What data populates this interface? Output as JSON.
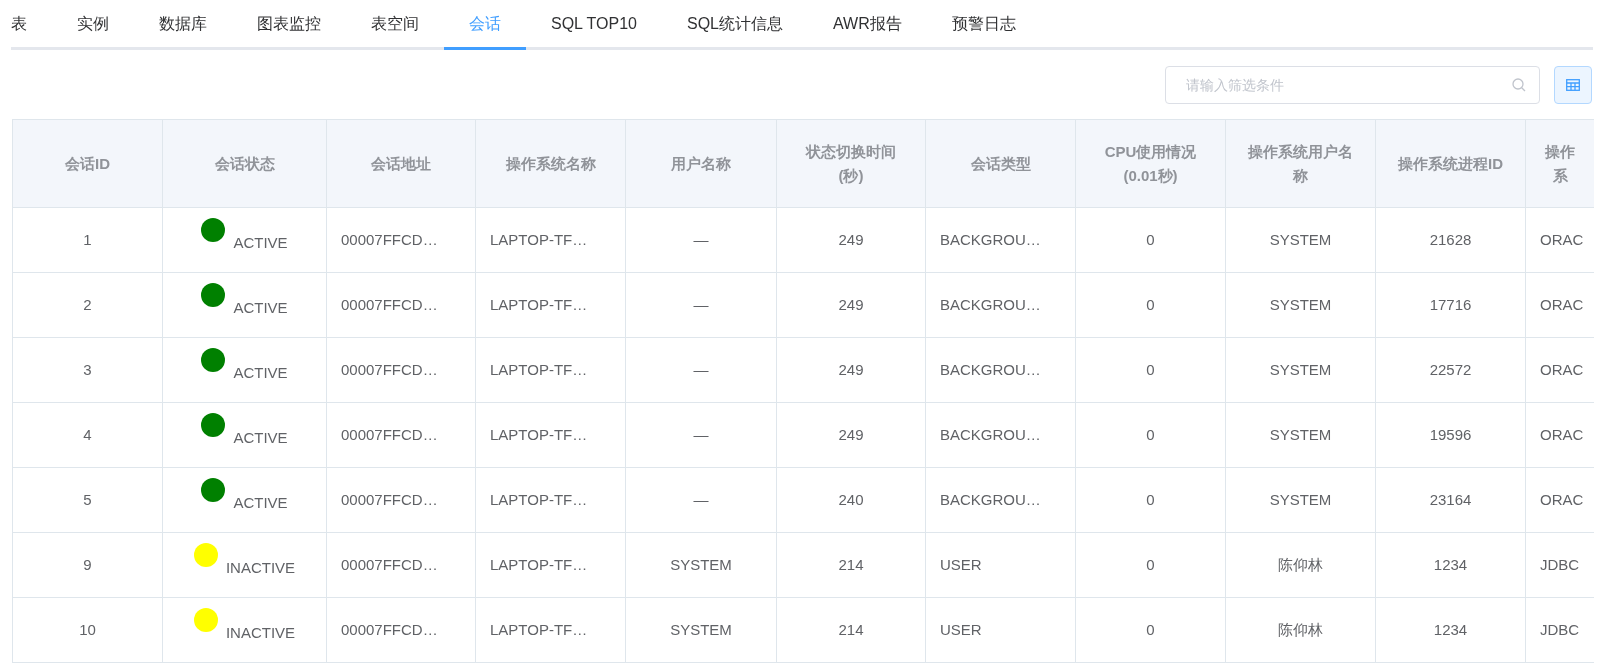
{
  "tabs": [
    {
      "label": "表",
      "selected": false
    },
    {
      "label": "实例",
      "selected": false
    },
    {
      "label": "数据库",
      "selected": false
    },
    {
      "label": "图表监控",
      "selected": false
    },
    {
      "label": "表空间",
      "selected": false
    },
    {
      "label": "会话",
      "selected": true
    },
    {
      "label": "SQL TOP10",
      "selected": false
    },
    {
      "label": "SQL统计信息",
      "selected": false
    },
    {
      "label": "AWR报告",
      "selected": false
    },
    {
      "label": "预警日志",
      "selected": false
    }
  ],
  "search": {
    "placeholder": "请输入筛选条件"
  },
  "table": {
    "columns": [
      "会话ID",
      "会话状态",
      "会话地址",
      "操作系统名称",
      "用户名称",
      "状态切换时间(秒)",
      "会话类型",
      "CPU使用情况(0.01秒)",
      "操作系统用户名称",
      "操作系统进程ID",
      "操作系"
    ],
    "rows": [
      {
        "cells": [
          "1",
          "ACTIVE",
          "00007FFCD…",
          "LAPTOP-TF…",
          "—",
          "249",
          "BACKGROU…",
          "0",
          "SYSTEM",
          "21628",
          "ORAC"
        ],
        "color": "#008000"
      },
      {
        "cells": [
          "2",
          "ACTIVE",
          "00007FFCD…",
          "LAPTOP-TF…",
          "—",
          "249",
          "BACKGROU…",
          "0",
          "SYSTEM",
          "17716",
          "ORAC"
        ],
        "color": "#008000"
      },
      {
        "cells": [
          "3",
          "ACTIVE",
          "00007FFCD…",
          "LAPTOP-TF…",
          "—",
          "249",
          "BACKGROU…",
          "0",
          "SYSTEM",
          "22572",
          "ORAC"
        ],
        "color": "#008000"
      },
      {
        "cells": [
          "4",
          "ACTIVE",
          "00007FFCD…",
          "LAPTOP-TF…",
          "—",
          "249",
          "BACKGROU…",
          "0",
          "SYSTEM",
          "19596",
          "ORAC"
        ],
        "color": "#008000"
      },
      {
        "cells": [
          "5",
          "ACTIVE",
          "00007FFCD…",
          "LAPTOP-TF…",
          "—",
          "240",
          "BACKGROU…",
          "0",
          "SYSTEM",
          "23164",
          "ORAC"
        ],
        "color": "#008000"
      },
      {
        "cells": [
          "9",
          "INACTIVE",
          "00007FFCD…",
          "LAPTOP-TF…",
          "SYSTEM",
          "214",
          "USER",
          "0",
          "陈仰林",
          "1234",
          "JDBC"
        ],
        "color": "#ffff00"
      },
      {
        "cells": [
          "10",
          "INACTIVE",
          "00007FFCD…",
          "LAPTOP-TF…",
          "SYSTEM",
          "214",
          "USER",
          "0",
          "陈仰林",
          "1234",
          "JDBC"
        ],
        "color": "#ffff00"
      }
    ]
  }
}
